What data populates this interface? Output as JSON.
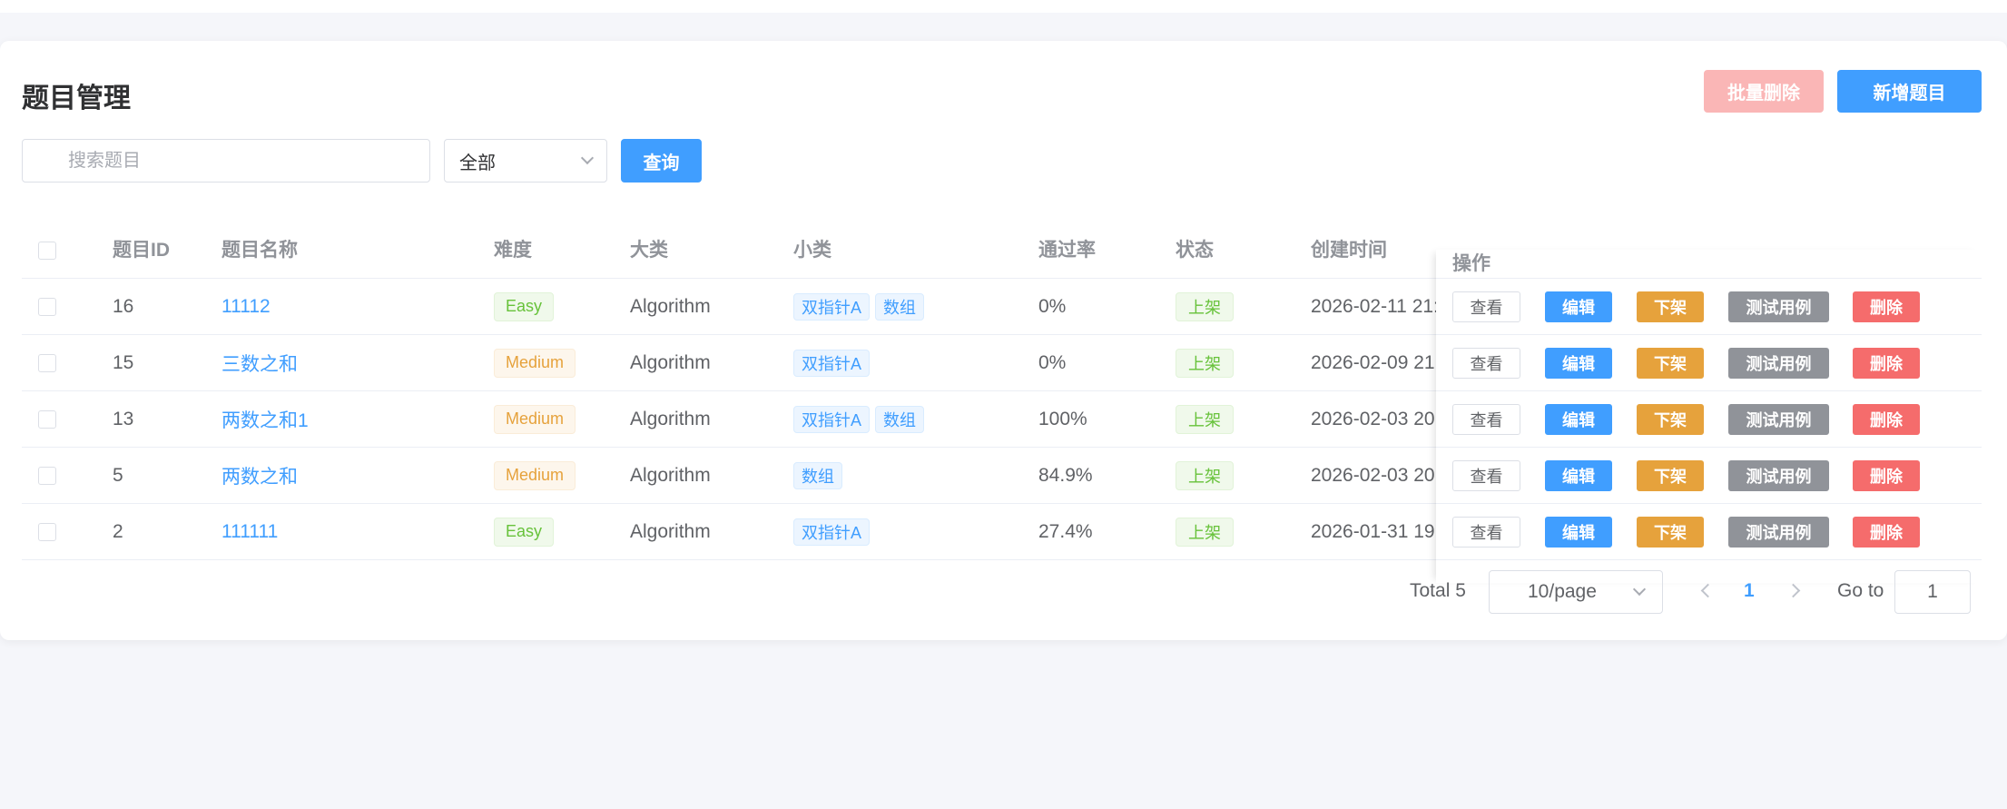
{
  "header": {
    "title": "题目管理",
    "batch_delete_label": "批量删除",
    "add_label": "新增题目"
  },
  "filters": {
    "search_placeholder": "搜索题目",
    "search_value": "",
    "status_select": "全部",
    "query_label": "查询"
  },
  "table": {
    "columns": [
      "题目ID",
      "题目名称",
      "难度",
      "大类",
      "小类",
      "通过率",
      "状态",
      "创建时间",
      "操作"
    ],
    "rows": [
      {
        "id": "16",
        "name": "11112",
        "difficulty": "Easy",
        "category": "Algorithm",
        "tags": [
          "双指针A",
          "数组"
        ],
        "pass_rate": "0%",
        "status": "上架",
        "created": "2026-02-11 21:"
      },
      {
        "id": "15",
        "name": "三数之和",
        "difficulty": "Medium",
        "category": "Algorithm",
        "tags": [
          "双指针A"
        ],
        "pass_rate": "0%",
        "status": "上架",
        "created": "2026-02-09 21:"
      },
      {
        "id": "13",
        "name": "两数之和1",
        "difficulty": "Medium",
        "category": "Algorithm",
        "tags": [
          "双指针A",
          "数组"
        ],
        "pass_rate": "100%",
        "status": "上架",
        "created": "2026-02-03 20:"
      },
      {
        "id": "5",
        "name": "两数之和",
        "difficulty": "Medium",
        "category": "Algorithm",
        "tags": [
          "数组"
        ],
        "pass_rate": "84.9%",
        "status": "上架",
        "created": "2026-02-03 20:"
      },
      {
        "id": "2",
        "name": "111111",
        "difficulty": "Easy",
        "category": "Algorithm",
        "tags": [
          "双指针A"
        ],
        "pass_rate": "27.4%",
        "status": "上架",
        "created": "2026-01-31 19:"
      }
    ],
    "actions": {
      "view": "查看",
      "edit": "编辑",
      "offline": "下架",
      "test_cases": "测试用例",
      "delete": "删除"
    }
  },
  "pagination": {
    "total_label": "Total 5",
    "page_size": "10/page",
    "current_page": "1",
    "goto_label": "Go to",
    "goto_value": "1"
  },
  "colors": {
    "primary": "#409eff",
    "danger": "#f56c6c",
    "danger_light": "#fab6b6",
    "warning": "#e6a23c",
    "info": "#909399",
    "success": "#67c23a"
  }
}
